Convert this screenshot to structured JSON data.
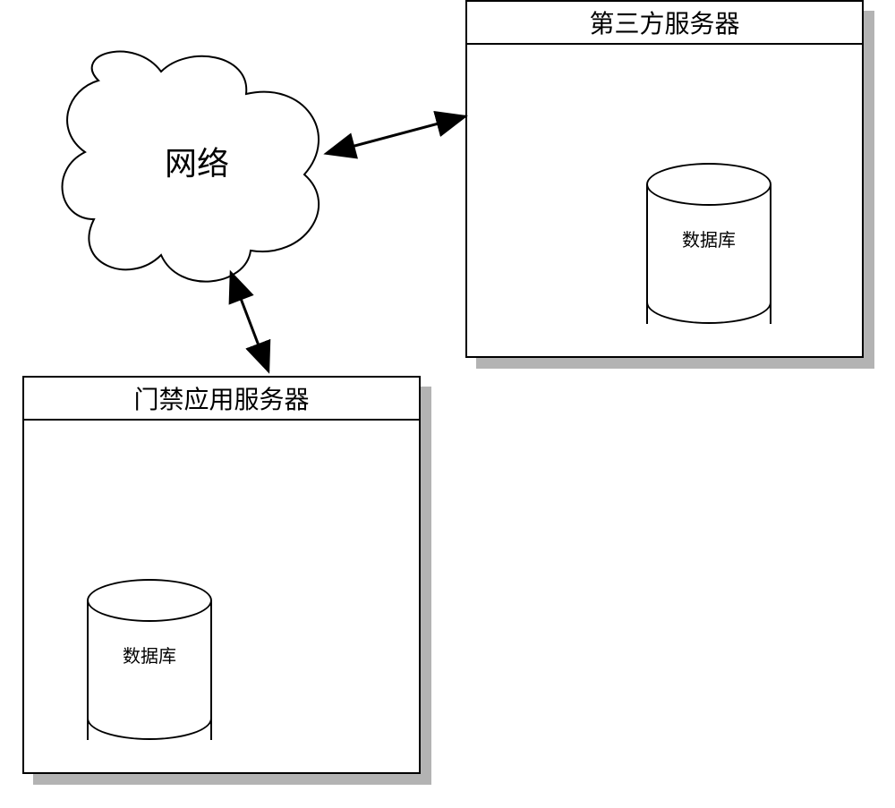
{
  "diagram": {
    "network_label": "网络",
    "server_thirdparty": {
      "title": "第三方服务器",
      "database_label": "数据库"
    },
    "server_access": {
      "title": "门禁应用服务器",
      "database_label": "数据库"
    }
  }
}
